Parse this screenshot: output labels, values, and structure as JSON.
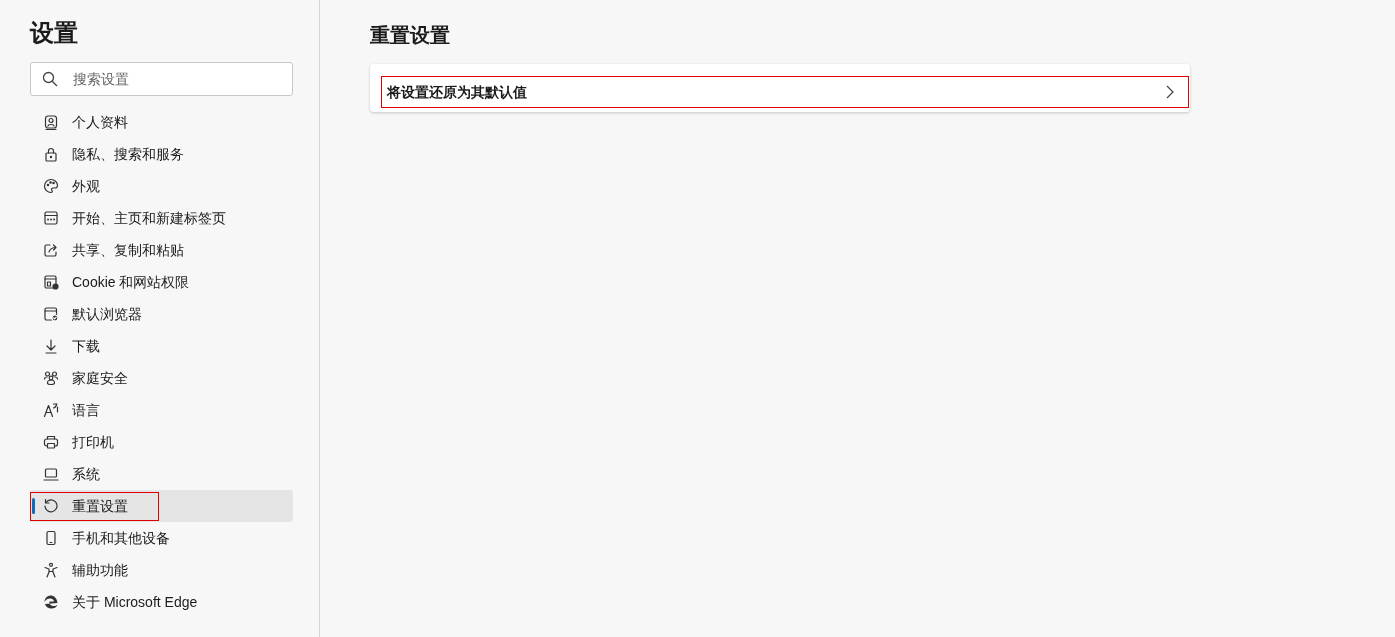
{
  "sidebar": {
    "title": "设置",
    "search": {
      "placeholder": "搜索设置"
    },
    "items": [
      {
        "label": "个人资料",
        "selected": false,
        "highlighted": false
      },
      {
        "label": "隐私、搜索和服务",
        "selected": false,
        "highlighted": false
      },
      {
        "label": "外观",
        "selected": false,
        "highlighted": false
      },
      {
        "label": "开始、主页和新建标签页",
        "selected": false,
        "highlighted": false
      },
      {
        "label": "共享、复制和粘贴",
        "selected": false,
        "highlighted": false
      },
      {
        "label": "Cookie 和网站权限",
        "selected": false,
        "highlighted": false
      },
      {
        "label": "默认浏览器",
        "selected": false,
        "highlighted": false
      },
      {
        "label": "下载",
        "selected": false,
        "highlighted": false
      },
      {
        "label": "家庭安全",
        "selected": false,
        "highlighted": false
      },
      {
        "label": "语言",
        "selected": false,
        "highlighted": false
      },
      {
        "label": "打印机",
        "selected": false,
        "highlighted": false
      },
      {
        "label": "系统",
        "selected": false,
        "highlighted": false
      },
      {
        "label": "重置设置",
        "selected": true,
        "highlighted": true
      },
      {
        "label": "手机和其他设备",
        "selected": false,
        "highlighted": false
      },
      {
        "label": "辅助功能",
        "selected": false,
        "highlighted": false
      },
      {
        "label": "关于 Microsoft Edge",
        "selected": false,
        "highlighted": false
      }
    ]
  },
  "main": {
    "title": "重置设置",
    "rows": [
      {
        "label": "将设置还原为其默认值",
        "highlighted": true
      }
    ]
  }
}
